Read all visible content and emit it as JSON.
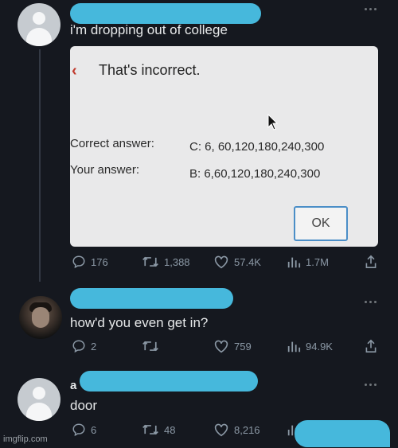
{
  "tweet_1": {
    "text": "i'm dropping out of college",
    "dialog": {
      "title": "That's incorrect.",
      "correct_label": "Correct answer:",
      "correct_value": "C: 6, 60,120,180,240,300",
      "your_label": "Your answer:",
      "your_value": "B: 6,60,120,180,240,300",
      "ok_label": "OK"
    },
    "actions": {
      "replies": "176",
      "reposts": "1,388",
      "likes": "57.4K",
      "views": "1.7M"
    }
  },
  "tweet_2": {
    "text": "how'd you even get in?",
    "actions": {
      "replies": "2",
      "reposts": "",
      "likes": "759",
      "views": "94.9K"
    }
  },
  "tweet_3": {
    "name_prefix": "a",
    "text": "door",
    "actions": {
      "replies": "6",
      "reposts": "48",
      "likes": "8,216"
    }
  },
  "watermark": "imgflip.com",
  "colors": {
    "background": "#15181f",
    "redaction": "#46b8dc",
    "icon_gray": "#8b98a5",
    "dialog_bg": "#e9e9ea",
    "ok_border": "#4b8ec7"
  }
}
